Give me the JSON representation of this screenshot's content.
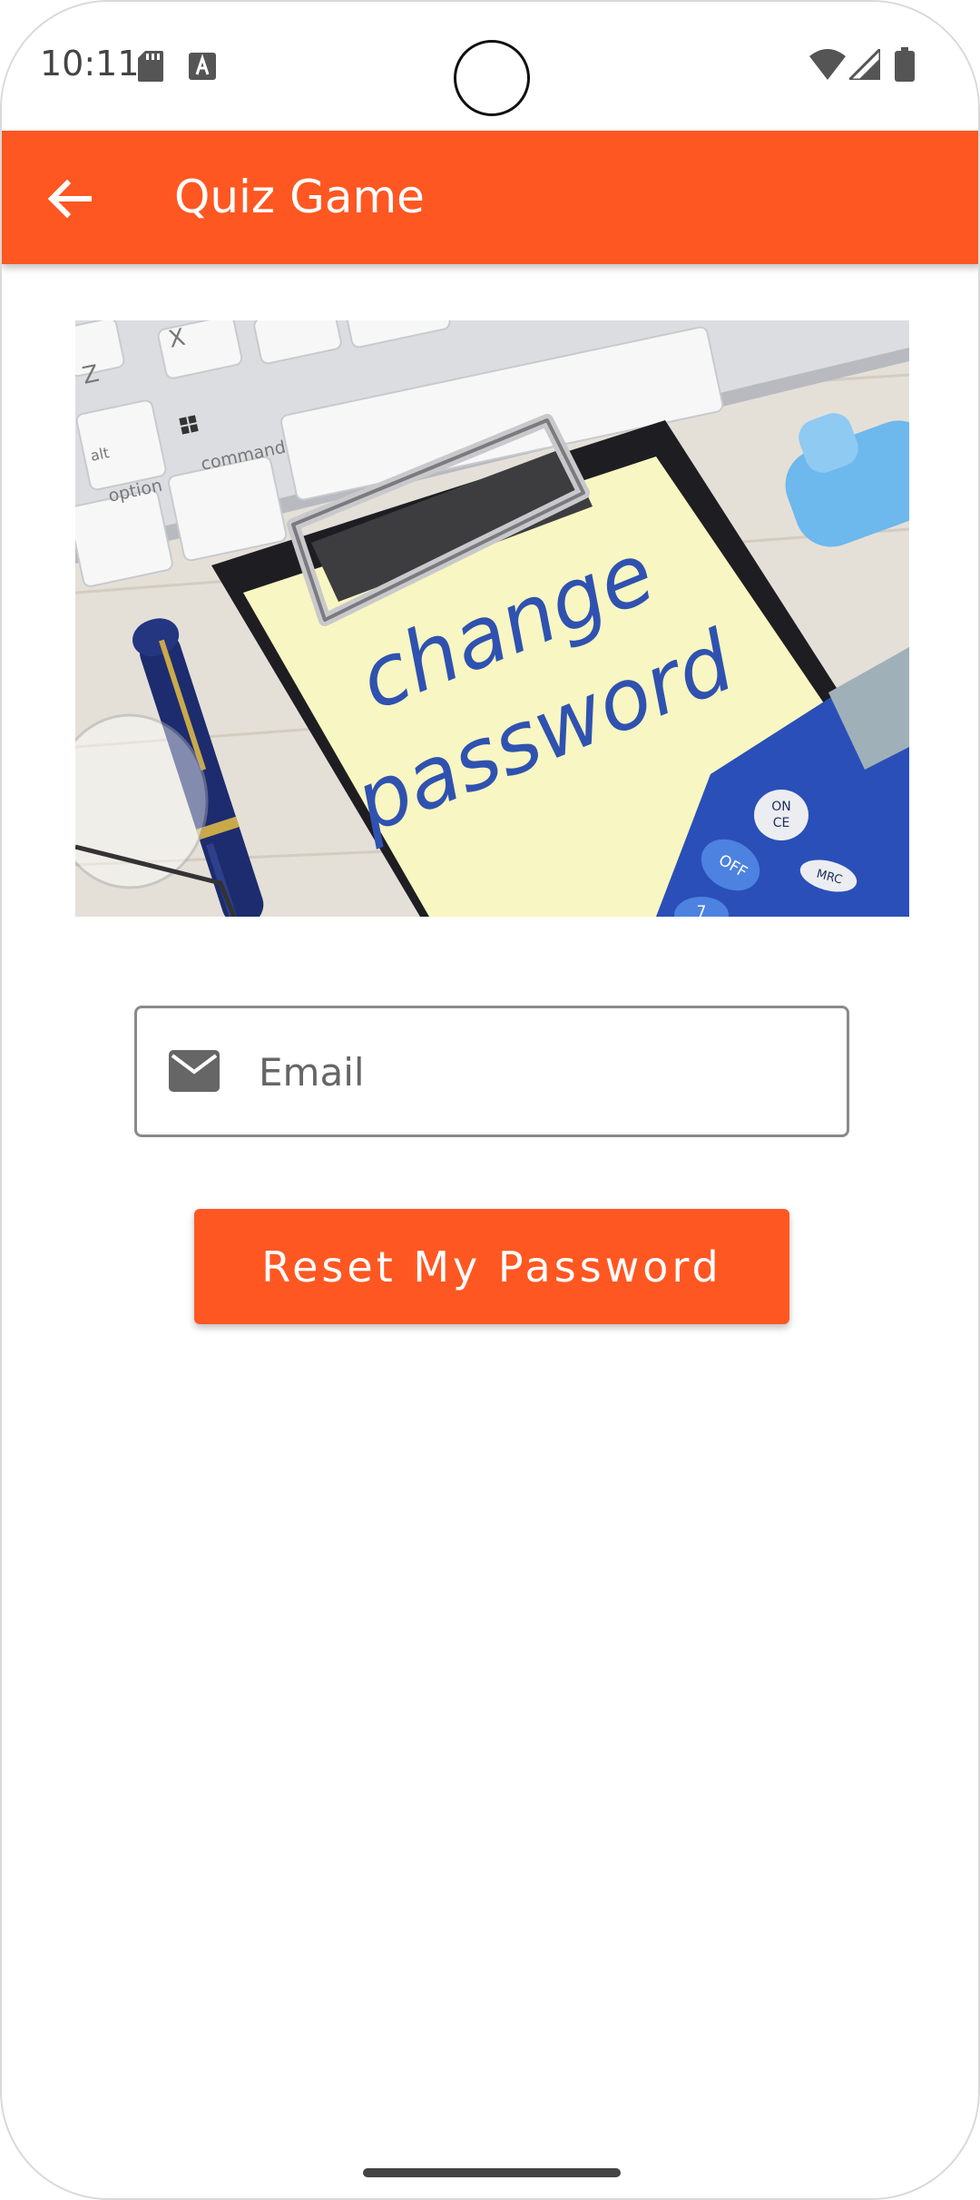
{
  "status_bar": {
    "time": "10:11",
    "icons": [
      "sd-card-icon",
      "a-notification-icon",
      "wifi-icon",
      "signal-icon",
      "battery-icon"
    ]
  },
  "app_bar": {
    "title": "Quiz Game",
    "back_icon": "arrow-left-icon",
    "color": "#ff5722"
  },
  "hero": {
    "note_line1": "change",
    "note_line2": "password",
    "key_option": "option",
    "key_command": "command",
    "key_alt": "alt",
    "key_z": "Z",
    "key_x": "X",
    "calc_on": "ON",
    "calc_ce": "CE",
    "calc_off": "OFF",
    "calc_mrc": "MRC",
    "calc_seven": "7"
  },
  "email": {
    "placeholder": "Email",
    "value": "",
    "icon": "mail-icon"
  },
  "reset_button": {
    "label": "Reset My Password",
    "color": "#ff5722"
  }
}
